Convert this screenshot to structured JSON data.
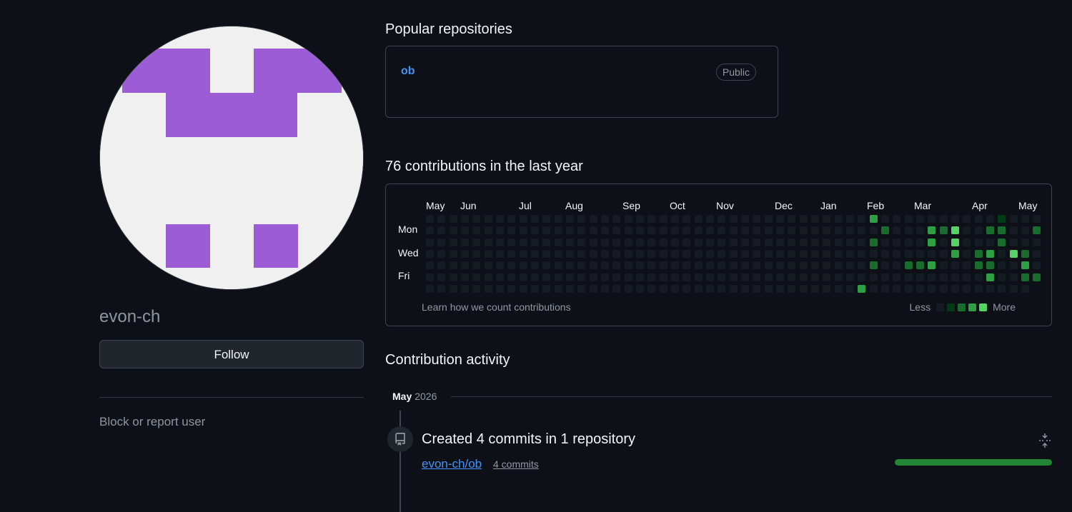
{
  "profile": {
    "username": "evon-ch",
    "follow_label": "Follow",
    "block_label": "Block or report user",
    "avatar_color": "#9b5cd6"
  },
  "popular": {
    "title": "Popular repositories",
    "repos": [
      {
        "name": "ob",
        "visibility": "Public"
      }
    ]
  },
  "contributions": {
    "title": "76 contributions in the last year",
    "months": [
      "May",
      "Jun",
      "Jul",
      "Aug",
      "Sep",
      "Oct",
      "Nov",
      "Dec",
      "Jan",
      "Feb",
      "Mar",
      "Apr",
      "May"
    ],
    "days": [
      "Mon",
      "Wed",
      "Fri"
    ],
    "learn_link": "Learn how we count contributions",
    "legend_less": "Less",
    "legend_more": "More",
    "colors": [
      "#151b23",
      "#033a16",
      "#196c2e",
      "#2ea043",
      "#56d364"
    ],
    "active_cells": [
      [
        37,
        6,
        3
      ],
      [
        38,
        0,
        3
      ],
      [
        38,
        2,
        2
      ],
      [
        38,
        4,
        2
      ],
      [
        39,
        1,
        2
      ],
      [
        41,
        4,
        2
      ],
      [
        42,
        4,
        2
      ],
      [
        43,
        1,
        3
      ],
      [
        43,
        2,
        3
      ],
      [
        43,
        4,
        3
      ],
      [
        44,
        1,
        2
      ],
      [
        45,
        1,
        4
      ],
      [
        45,
        2,
        4
      ],
      [
        45,
        3,
        3
      ],
      [
        47,
        3,
        2
      ],
      [
        47,
        4,
        2
      ],
      [
        48,
        1,
        2
      ],
      [
        48,
        3,
        3
      ],
      [
        48,
        4,
        2
      ],
      [
        48,
        5,
        3
      ],
      [
        49,
        0,
        1
      ],
      [
        49,
        1,
        2
      ],
      [
        49,
        2,
        2
      ],
      [
        50,
        3,
        4
      ],
      [
        51,
        3,
        2
      ],
      [
        51,
        4,
        3
      ],
      [
        51,
        5,
        2
      ],
      [
        52,
        1,
        2
      ],
      [
        52,
        5,
        2
      ],
      [
        53,
        6,
        1
      ],
      [
        54,
        2,
        2
      ],
      [
        54,
        3,
        2
      ]
    ]
  },
  "activity": {
    "title": "Contribution activity",
    "month": "May",
    "year": "2026",
    "event_title": "Created 4 commits in 1 repository",
    "repo": "evon-ch/ob",
    "commits": "4 commits",
    "share": 1.0
  }
}
